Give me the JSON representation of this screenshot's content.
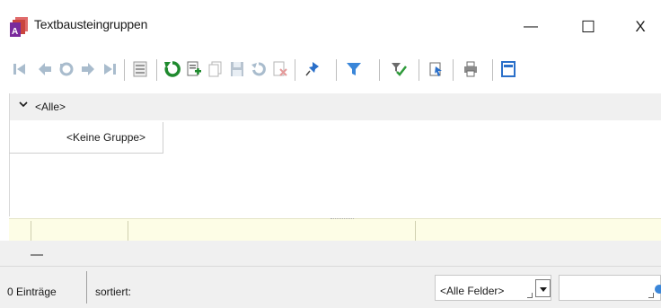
{
  "window": {
    "title": "Textbausteingruppen",
    "minimize_glyph": "—",
    "maximize_glyph": "☐",
    "close_glyph": "X"
  },
  "toolbar": {
    "icons": [
      "first-record-icon",
      "previous-record-icon",
      "undo-icon",
      "next-record-icon",
      "last-record-icon",
      "details-view-icon",
      "refresh-icon",
      "new-record-icon",
      "copy-record-icon",
      "save-icon",
      "revert-icon",
      "delete-icon",
      "pin-icon",
      "filter-icon",
      "check-filter-icon",
      "export-icon",
      "print-icon",
      "layout-icon"
    ],
    "colors": {
      "refresh": "#1f8a2e",
      "pin": "#2a6fc9",
      "filter": "#3a86d9",
      "disabled": "#a9bccd"
    }
  },
  "grid": {
    "group_header_label": "<Alle>",
    "rows": [
      {
        "label": "<Keine Gruppe>"
      }
    ]
  },
  "status": {
    "entries_label": "0 Einträge",
    "sorted_label": "sortiert:",
    "field_select_value": "<Alle Felder>",
    "search_value": ""
  }
}
